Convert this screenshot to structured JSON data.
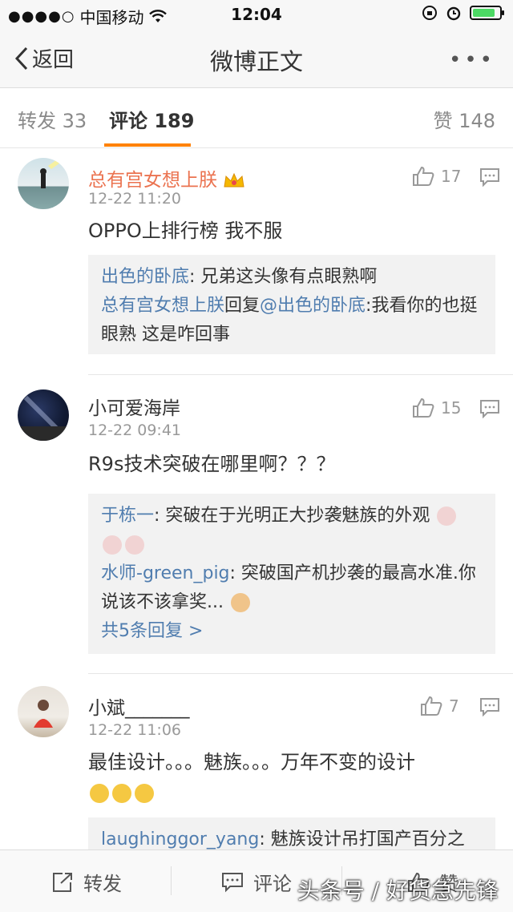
{
  "status_bar": {
    "signal_dots": "●●●●○",
    "carrier": "中国移动",
    "time": "12:04"
  },
  "nav": {
    "back_label": "返回",
    "title": "微博正文",
    "more": "•••"
  },
  "tabs": [
    {
      "label": "转发",
      "count": "33"
    },
    {
      "label": "评论",
      "count": "189"
    },
    {
      "label": "赞",
      "count": "148"
    }
  ],
  "comments": [
    {
      "name": "总有宫女想上朕",
      "time": "12-22 11:20",
      "likes": "17",
      "text": "OPPO上排行榜 我不服",
      "replies": [
        {
          "user": "出色的卧底",
          "text": ": 兄弟这头像有点眼熟啊"
        },
        {
          "user": "总有宫女想上朕",
          "mid": "回复",
          "mention": "@出色的卧底",
          "text": ":我看你的也挺眼熟 这是咋回事"
        }
      ]
    },
    {
      "name": "小可爱海岸",
      "time": "12-22 09:41",
      "likes": "15",
      "text": "R9s技术突破在哪里啊？？？",
      "replies": [
        {
          "user": "于栋一",
          "text": ": 突破在于光明正大抄袭魅族的外观"
        },
        {
          "user": "水师-green_pig",
          "text": ": 突破国产机抄袭的最高水准.你说该不该拿奖..."
        }
      ],
      "more_replies": "共5条回复 >"
    },
    {
      "name": "小斌_______",
      "time": "12-22 11:06",
      "likes": "7",
      "text": "最佳设计。。。魅族。。。万年不变的设计",
      "replies": [
        {
          "user": "laughinggor_yang",
          "text": ": 魅族设计吊打国产百分之"
        }
      ]
    }
  ],
  "bottom_bar": {
    "repost": "转发",
    "comment": "评论",
    "like": "赞"
  },
  "watermark": "头条号 / 好货急先锋",
  "colors": {
    "accent": "#ff8200",
    "link": "#507daf",
    "vip_name": "#eb7350"
  }
}
